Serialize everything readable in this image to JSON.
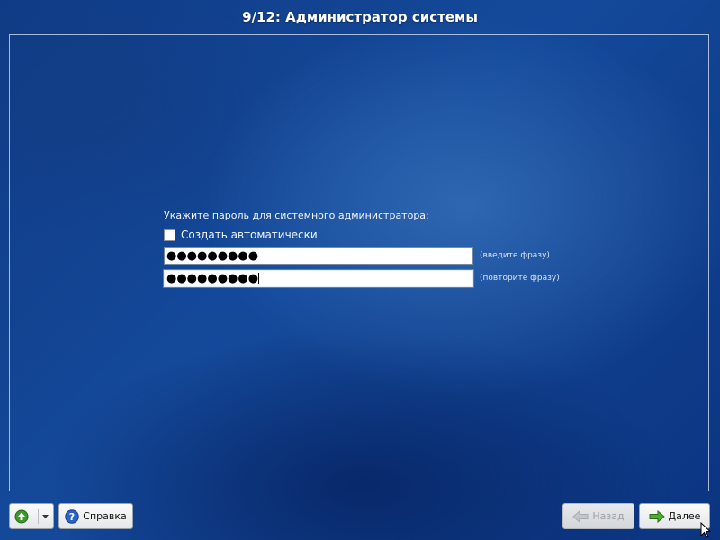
{
  "window": {
    "title": "9/12: Администратор системы"
  },
  "form": {
    "prompt": "Укажите пароль для системного администратора:",
    "auto_checkbox_label": "Создать автоматически",
    "auto_checkbox_checked": false,
    "password_field": {
      "value": "●●●●●●●●●",
      "hint": "(введите фразу)"
    },
    "confirm_field": {
      "value": "●●●●●●●●●",
      "hint": "(повторите фразу)"
    }
  },
  "buttons": {
    "update_menu_icon": "green-up-arrow-icon",
    "help_label": "Справка",
    "help_icon": "help-question-icon",
    "back_label": "Назад",
    "back_disabled": true,
    "next_label": "Далее"
  },
  "colors": {
    "background": "#0d3a85",
    "accent_green": "#3a9a2a",
    "help_blue": "#2a63c8"
  }
}
